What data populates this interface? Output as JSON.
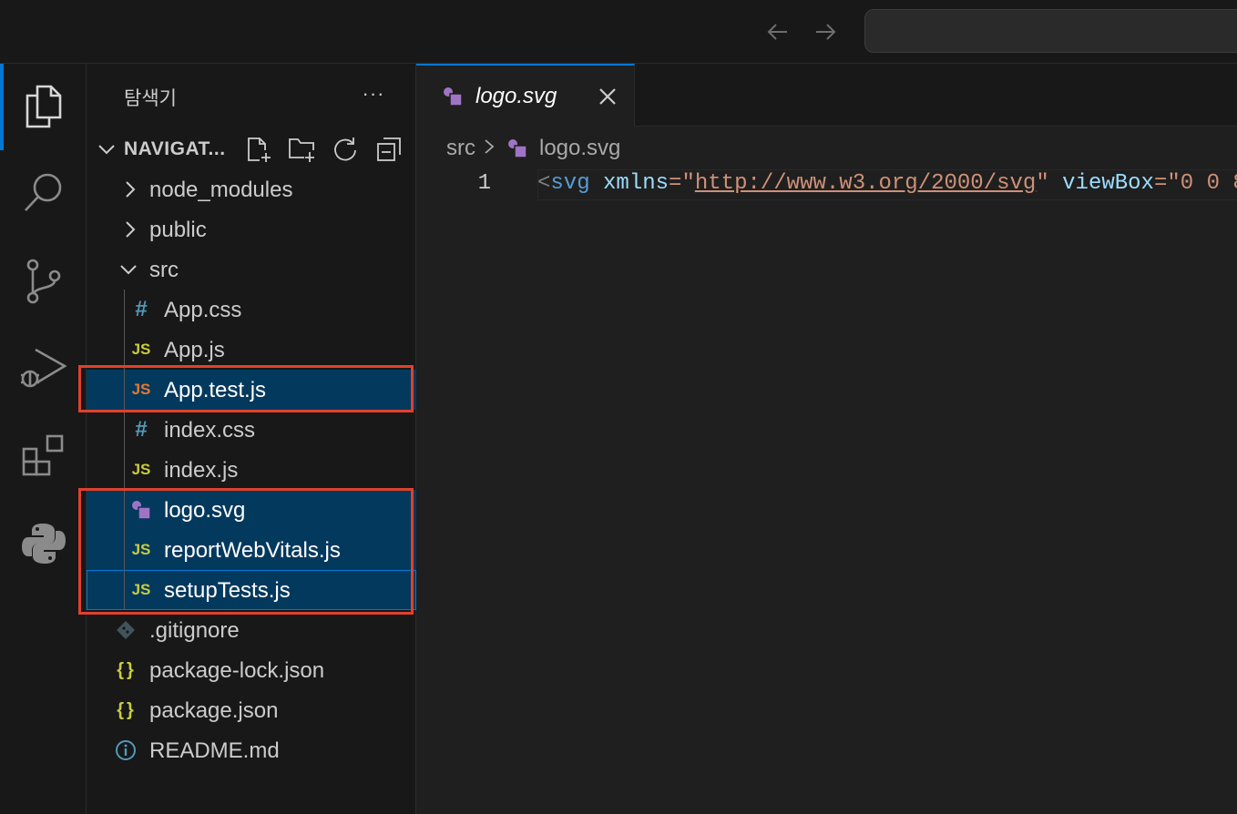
{
  "titlebar": {
    "back_icon": "arrow-left-icon",
    "forward_icon": "arrow-right-icon"
  },
  "activity_bar": {
    "items": [
      "explorer-icon",
      "search-icon",
      "source-control-icon",
      "run-debug-icon",
      "extensions-icon",
      "python-icon"
    ],
    "active": "explorer-icon"
  },
  "sidebar": {
    "title": "탐색기",
    "more": "···",
    "section": {
      "title": "NAVIGAT...",
      "actions": [
        "new-file-icon",
        "new-folder-icon",
        "refresh-icon",
        "collapse-all-icon"
      ]
    },
    "tree": [
      {
        "label": "node_modules",
        "type": "folder",
        "expanded": false
      },
      {
        "label": "public",
        "type": "folder",
        "expanded": false
      },
      {
        "label": "src",
        "type": "folder",
        "expanded": true
      },
      {
        "label": "App.css",
        "type": "css",
        "icon_text": "#"
      },
      {
        "label": "App.js",
        "type": "js",
        "icon_text": "JS"
      },
      {
        "label": "App.test.js",
        "type": "test-js",
        "icon_text": "JS"
      },
      {
        "label": "index.css",
        "type": "css",
        "icon_text": "#"
      },
      {
        "label": "index.js",
        "type": "js",
        "icon_text": "JS"
      },
      {
        "label": "logo.svg",
        "type": "svg"
      },
      {
        "label": "reportWebVitals.js",
        "type": "js",
        "icon_text": "JS"
      },
      {
        "label": "setupTests.js",
        "type": "js",
        "icon_text": "JS"
      },
      {
        "label": ".gitignore",
        "type": "git"
      },
      {
        "label": "package-lock.json",
        "type": "json",
        "icon_text": "{}"
      },
      {
        "label": "package.json",
        "type": "json",
        "icon_text": "{}"
      },
      {
        "label": "README.md",
        "type": "info",
        "icon_text": "i"
      }
    ],
    "selected": [
      "App.test.js",
      "logo.svg",
      "reportWebVitals.js",
      "setupTests.js"
    ],
    "focused": "setupTests.js"
  },
  "editor": {
    "tab": {
      "label": "logo.svg",
      "close_icon": "close-icon"
    },
    "breadcrumb": {
      "folder": "src",
      "separator": ">",
      "file": "logo.svg"
    },
    "line_number": "1",
    "code": {
      "open": "<",
      "tag": "svg",
      "attr1": "xmlns",
      "eq1": "=\"",
      "url": "http://www.w3.org/2000/svg",
      "close1": "\"",
      "attr2": "viewBox",
      "eq2": "=\"",
      "val2": "0 0 8"
    }
  },
  "colors": {
    "accent": "#0078d4",
    "selection": "#04395e",
    "highlight_box": "#e0412b",
    "js_icon": "#cbcb41",
    "test_js_icon": "#e37933",
    "css_icon": "#519aba",
    "svg_icon": "#a074c4"
  }
}
